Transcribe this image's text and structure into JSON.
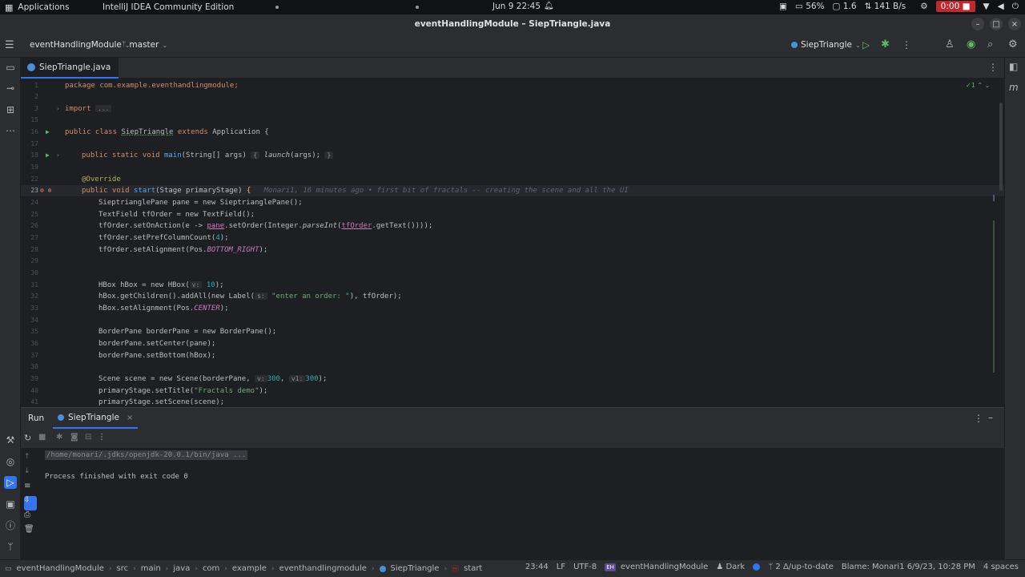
{
  "os": {
    "apps_label": "Applications",
    "app_name": "IntelliJ IDEA Community Edition",
    "clock": "Jun 9  22:45",
    "battery": "56%",
    "load": "1.6",
    "network": "141 B/s",
    "record": "0:00"
  },
  "window": {
    "title": "eventHandlingModule – SiepTriangle.java"
  },
  "toolbar": {
    "project": "eventHandlingModule",
    "branch": "master",
    "run_config": "SiepTriangle"
  },
  "tabs": [
    {
      "label": "SiepTriangle.java",
      "close": "×"
    }
  ],
  "editor": {
    "inspection_count": "1",
    "line_numbers": [
      "1",
      "2",
      "3",
      "15",
      "16",
      "17",
      "18",
      "19",
      "22",
      "23",
      "24",
      "25",
      "26",
      "27",
      "28",
      "29",
      "30",
      "31",
      "32",
      "33",
      "34",
      "35",
      "36",
      "37",
      "38",
      "39",
      "40",
      "41"
    ],
    "line_pkg": "package com.example.eventhandlingmodule;",
    "line_import_kw": "import",
    "line_import_fold": "...",
    "line_class": {
      "k1": "public class ",
      "name": "SiepTriangle",
      "k2": " extends ",
      "rest": "Application {"
    },
    "line_main": {
      "k": "public static void ",
      "fn": "main",
      "rest": "(String[] args) ",
      "brace1": "{",
      "call": "launch",
      "args": "(args);",
      "brace2": "}"
    },
    "line_override": "@Override",
    "line_start": {
      "k": "public void ",
      "fn": "start",
      "rest": "(Stage primaryStage) ",
      "brace": "{"
    },
    "blame_inline": "Monari1, 16 minutes ago • first bit of fractals -- creating the scene and all the UI",
    "l24": "SieptrianglePane pane = new SieptrianglePane();",
    "l25": "TextField tfOrder = new TextField();",
    "l26": {
      "a": "tfOrder.setOnAction(e -> ",
      "b": "pane",
      "c": ".setOrder(Integer.",
      "d": "parseInt",
      "e": "(",
      "f": "tfOrder",
      "g": ".getText())));"
    },
    "l27": {
      "a": "tfOrder.setPrefColumnCount(",
      "n": "4",
      "b": ");"
    },
    "l28": {
      "a": "tfOrder.setAlignment(Pos.",
      "c": "BOTTOM_RIGHT",
      "b": ");"
    },
    "l31": {
      "a": "HBox hBox = new HBox(",
      "hint": "v:",
      "n": "10",
      "b": ");"
    },
    "l32": {
      "a": "hBox.getChildren().addAll(new Label(",
      "hint": "s:",
      "s": "\"enter an order: \"",
      "b": "), tfOrder);"
    },
    "l33": {
      "a": "hBox.setAlignment(Pos.",
      "c": "CENTER",
      "b": ");"
    },
    "l35": "BorderPane borderPane = new BorderPane();",
    "l36": "borderPane.setCenter(pane);",
    "l37": "borderPane.setBottom(hBox);",
    "l39": {
      "a": "Scene scene = new Scene(borderPane, ",
      "h1": "v:",
      "n1": "300",
      "c": ", ",
      "h2": "v1:",
      "n2": "300",
      "b": ");"
    },
    "l40": {
      "a": "primaryStage.setTitle(",
      "s": "\"Fractals demo\"",
      "b": ");"
    },
    "l41": "primaryStage.setScene(scene);"
  },
  "run_panel": {
    "title": "Run",
    "tab": "SiepTriangle",
    "tab_close": "×",
    "cmd": "/home/monari/.jdks/openjdk-20.0.1/bin/java ...",
    "exit": "Process finished with exit code 0"
  },
  "status": {
    "breadcrumbs": [
      "eventHandlingModule",
      "src",
      "main",
      "java",
      "com",
      "example",
      "eventhandlingmodule",
      "SiepTriangle",
      "start"
    ],
    "position": "23:44",
    "line_sep": "LF",
    "encoding": "UTF-8",
    "module_badge": "EH",
    "module": "eventHandlingModule",
    "theme": "Dark",
    "vcs": "2 Δ/up-to-date",
    "blame": "Blame: Monari1 6/9/23, 10:28 PM",
    "indent": "4 spaces"
  }
}
